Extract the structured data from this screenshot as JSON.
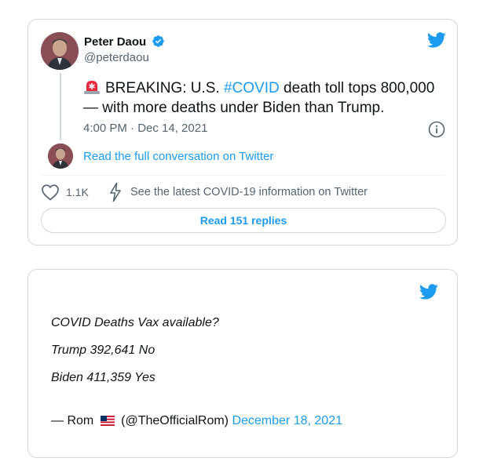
{
  "tweet": {
    "author_name": "Peter Daou",
    "handle": "@peterdaou",
    "text_prefix": "BREAKING: U.S. ",
    "hashtag": "#COVID",
    "text_suffix": " death toll tops 800,000 — with more deaths under Biden than Trump.",
    "timestamp": "4:00 PM · Dec 14, 2021",
    "read_conversation": "Read the full conversation on Twitter",
    "likes": "1.1K",
    "covid_info": "See the latest COVID-19 information on Twitter",
    "replies_button": "Read 151 replies",
    "icons": {
      "logo": "twitter-bird-icon",
      "verified": "verified-badge-icon",
      "siren": "rotating-light-emoji",
      "info": "info-icon",
      "like": "heart-icon",
      "covid": "lightning-bolt-icon"
    }
  },
  "embed": {
    "lines": [
      "COVID Deaths Vax available?",
      "Trump 392,641 No",
      "Biden 411,359 Yes"
    ],
    "attribution_prefix": "— Rom",
    "attribution_handle": "(@TheOfficialRom)",
    "attribution_date": "December 18, 2021",
    "icons": {
      "logo": "twitter-bird-icon",
      "flag": "us-flag-emoji"
    }
  },
  "colors": {
    "accent": "#1d9bf0",
    "text": "#0f1419",
    "secondary": "#536471",
    "border": "#cfd9de"
  }
}
